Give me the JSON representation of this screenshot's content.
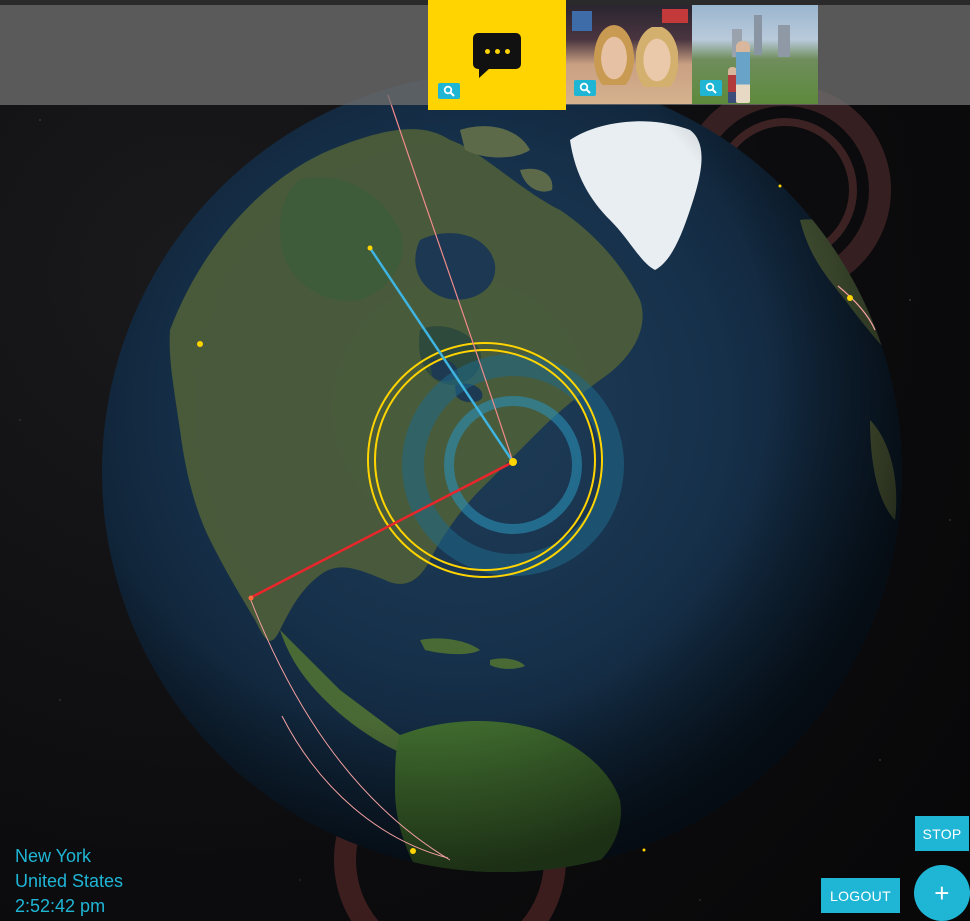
{
  "header": {
    "chat_tile": {
      "icon": "chat-bubble-icon",
      "accent": "#ffd400"
    },
    "photos": [
      {
        "name": "photo-times-square",
        "icon": "search-icon"
      },
      {
        "name": "photo-central-park",
        "icon": "search-icon"
      }
    ]
  },
  "location": {
    "city": "New York",
    "country": "United States",
    "time": "2:52:42 pm"
  },
  "controls": {
    "stop_label": "STOP",
    "logout_label": "LOGOUT",
    "add_label": "+"
  },
  "colors": {
    "accent": "#1fb6d6",
    "highlight": "#ffd400",
    "route_primary": "#e8262b",
    "route_secondary": "#3fb4e0",
    "pulse_ring": "#7a3b3b"
  }
}
